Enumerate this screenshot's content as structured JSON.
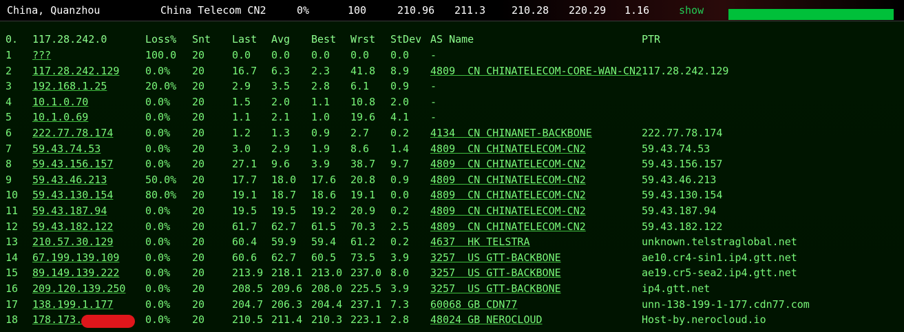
{
  "summary": {
    "location": "China, Quanzhou",
    "isp": "China Telecom CN2",
    "loss": "0%",
    "sent": "100",
    "last": "210.96",
    "avg": "211.3",
    "best": "210.28",
    "worst": "220.29",
    "stdev": "1.16",
    "show_label": "show",
    "bar_color": "#00c03a"
  },
  "header": {
    "idx": "0.",
    "host": "117.28.242.0",
    "loss": "Loss%",
    "snt": "Snt",
    "last": "Last",
    "avg": "Avg",
    "best": "Best",
    "wrst": "Wrst",
    "stdev": "StDev",
    "as": "AS Name",
    "ptr": "PTR"
  },
  "rows": [
    {
      "idx": "1",
      "host": "???",
      "loss": "100.0",
      "snt": "20",
      "last": "0.0",
      "avg": "0.0",
      "best": "0.0",
      "wrst": "0.0",
      "stdev": "0.0",
      "as": "-",
      "ptr": ""
    },
    {
      "idx": "2",
      "host": "117.28.242.129",
      "loss": "0.0%",
      "snt": "20",
      "last": "16.7",
      "avg": "6.3",
      "best": "2.3",
      "wrst": "41.8",
      "stdev": "8.9",
      "as": "4809  CN CHINATELECOM-CORE-WAN-CN2",
      "ptr": "117.28.242.129"
    },
    {
      "idx": "3",
      "host": "192.168.1.25",
      "loss": "20.0%",
      "snt": "20",
      "last": "2.9",
      "avg": "3.5",
      "best": "2.8",
      "wrst": "6.1",
      "stdev": "0.9",
      "as": "-",
      "ptr": ""
    },
    {
      "idx": "4",
      "host": "10.1.0.70",
      "loss": "0.0%",
      "snt": "20",
      "last": "1.5",
      "avg": "2.0",
      "best": "1.1",
      "wrst": "10.8",
      "stdev": "2.0",
      "as": "-",
      "ptr": ""
    },
    {
      "idx": "5",
      "host": "10.1.0.69",
      "loss": "0.0%",
      "snt": "20",
      "last": "1.1",
      "avg": "2.1",
      "best": "1.0",
      "wrst": "19.6",
      "stdev": "4.1",
      "as": "-",
      "ptr": ""
    },
    {
      "idx": "6",
      "host": "222.77.78.174",
      "loss": "0.0%",
      "snt": "20",
      "last": "1.2",
      "avg": "1.3",
      "best": "0.9",
      "wrst": "2.7",
      "stdev": "0.2",
      "as": "4134  CN CHINANET-BACKBONE",
      "ptr": "222.77.78.174"
    },
    {
      "idx": "7",
      "host": "59.43.74.53",
      "loss": "0.0%",
      "snt": "20",
      "last": "3.0",
      "avg": "2.9",
      "best": "1.9",
      "wrst": "8.6",
      "stdev": "1.4",
      "as": "4809  CN CHINATELECOM-CN2",
      "ptr": "59.43.74.53"
    },
    {
      "idx": "8",
      "host": "59.43.156.157",
      "loss": "0.0%",
      "snt": "20",
      "last": "27.1",
      "avg": "9.6",
      "best": "3.9",
      "wrst": "38.7",
      "stdev": "9.7",
      "as": "4809  CN CHINATELECOM-CN2",
      "ptr": "59.43.156.157"
    },
    {
      "idx": "9",
      "host": "59.43.46.213",
      "loss": "50.0%",
      "snt": "20",
      "last": "17.7",
      "avg": "18.0",
      "best": "17.6",
      "wrst": "20.8",
      "stdev": "0.9",
      "as": "4809  CN CHINATELECOM-CN2",
      "ptr": "59.43.46.213"
    },
    {
      "idx": "10",
      "host": "59.43.130.154",
      "loss": "80.0%",
      "snt": "20",
      "last": "19.1",
      "avg": "18.7",
      "best": "18.6",
      "wrst": "19.1",
      "stdev": "0.0",
      "as": "4809  CN CHINATELECOM-CN2",
      "ptr": "59.43.130.154"
    },
    {
      "idx": "11",
      "host": "59.43.187.94",
      "loss": "0.0%",
      "snt": "20",
      "last": "19.5",
      "avg": "19.5",
      "best": "19.2",
      "wrst": "20.9",
      "stdev": "0.2",
      "as": "4809  CN CHINATELECOM-CN2",
      "ptr": "59.43.187.94"
    },
    {
      "idx": "12",
      "host": "59.43.182.122",
      "loss": "0.0%",
      "snt": "20",
      "last": "61.7",
      "avg": "62.7",
      "best": "61.5",
      "wrst": "70.3",
      "stdev": "2.5",
      "as": "4809  CN CHINATELECOM-CN2",
      "ptr": "59.43.182.122"
    },
    {
      "idx": "13",
      "host": "210.57.30.129",
      "loss": "0.0%",
      "snt": "20",
      "last": "60.4",
      "avg": "59.9",
      "best": "59.4",
      "wrst": "61.2",
      "stdev": "0.2",
      "as": "4637  HK TELSTRA",
      "ptr": "unknown.telstraglobal.net"
    },
    {
      "idx": "14",
      "host": "67.199.139.109",
      "loss": "0.0%",
      "snt": "20",
      "last": "60.6",
      "avg": "62.7",
      "best": "60.5",
      "wrst": "73.5",
      "stdev": "3.9",
      "as": "3257  US GTT-BACKBONE",
      "ptr": "ae10.cr4-sin1.ip4.gtt.net"
    },
    {
      "idx": "15",
      "host": "89.149.139.222",
      "loss": "0.0%",
      "snt": "20",
      "last": "213.9",
      "avg": "218.1",
      "best": "213.0",
      "wrst": "237.0",
      "stdev": "8.0",
      "as": "3257  US GTT-BACKBONE",
      "ptr": "ae19.cr5-sea2.ip4.gtt.net"
    },
    {
      "idx": "16",
      "host": "209.120.139.250",
      "loss": "0.0%",
      "snt": "20",
      "last": "208.5",
      "avg": "209.6",
      "best": "208.0",
      "wrst": "225.5",
      "stdev": "3.9",
      "as": "3257  US GTT-BACKBONE",
      "ptr": "ip4.gtt.net"
    },
    {
      "idx": "17",
      "host": "138.199.1.177",
      "loss": "0.0%",
      "snt": "20",
      "last": "204.7",
      "avg": "206.3",
      "best": "204.4",
      "wrst": "237.1",
      "stdev": "7.3",
      "as": "60068 GB CDN77",
      "ptr": "unn-138-199-1-177.cdn77.com"
    },
    {
      "idx": "18",
      "host": "178.173.",
      "loss": "0.0%",
      "snt": "20",
      "last": "210.5",
      "avg": "211.4",
      "best": "210.3",
      "wrst": "223.1",
      "stdev": "2.8",
      "as": "48024 GB NEROCLOUD",
      "ptr": "Host-by.nerocloud.io"
    }
  ]
}
